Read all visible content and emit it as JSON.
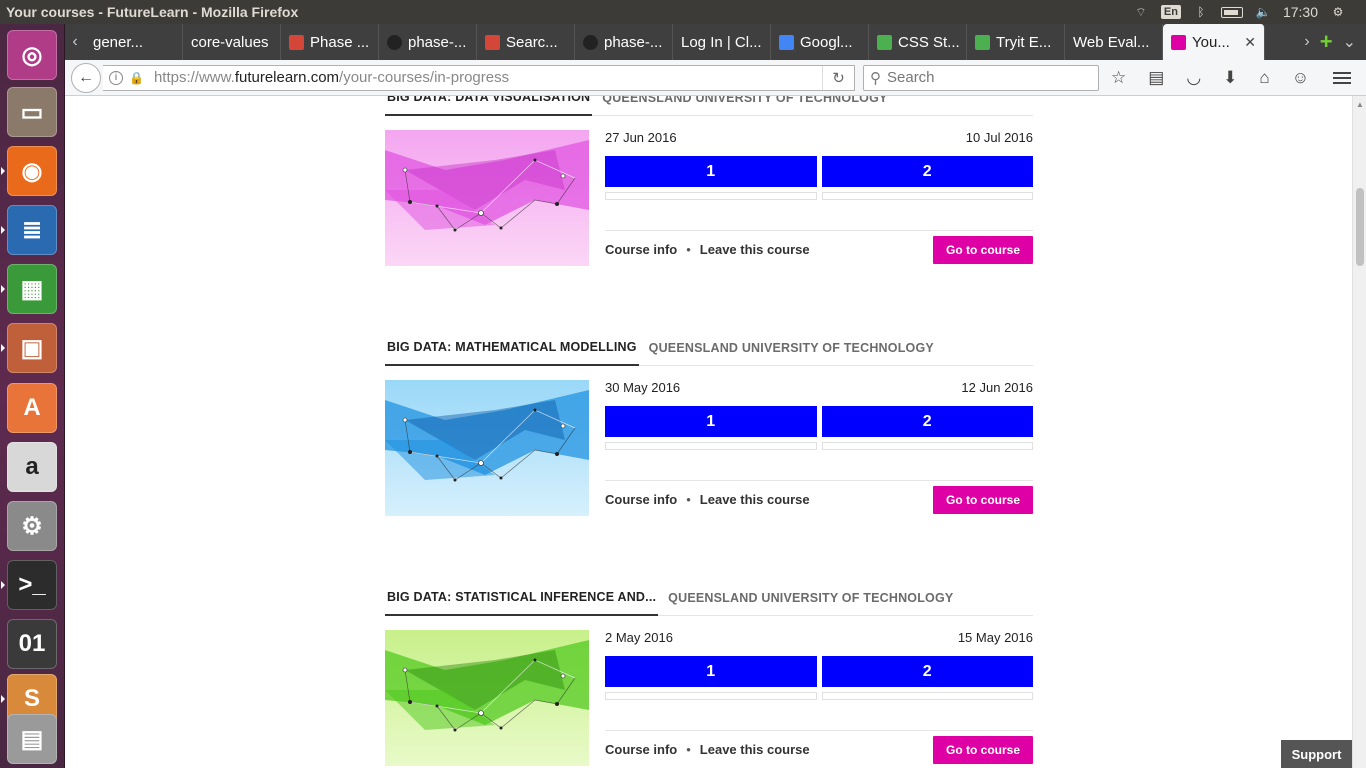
{
  "window": {
    "title": "Your courses - FutureLearn - Mozilla Firefox"
  },
  "tray": {
    "language": "En",
    "time": "17:30"
  },
  "launcher": {
    "items": [
      {
        "name": "ubuntu-dash",
        "glyph": "◎",
        "color": "#b03b87"
      },
      {
        "name": "files",
        "glyph": "▭",
        "color": "#8b7a6a"
      },
      {
        "name": "firefox",
        "glyph": "◉",
        "color": "#e86a1a"
      },
      {
        "name": "libreoffice-writer",
        "glyph": "≣",
        "color": "#2a6ab0"
      },
      {
        "name": "libreoffice-calc",
        "glyph": "▦",
        "color": "#3a9a3a"
      },
      {
        "name": "libreoffice-impress",
        "glyph": "▣",
        "color": "#c0603a"
      },
      {
        "name": "software-center",
        "glyph": "A",
        "color": "#e8743a"
      },
      {
        "name": "amazon",
        "glyph": "a",
        "color": "#d8d8d8"
      },
      {
        "name": "system-settings",
        "glyph": "⚙",
        "color": "#8a8a8a"
      },
      {
        "name": "terminal",
        "glyph": ">_",
        "color": "#2c2c2c"
      },
      {
        "name": "binary-editor",
        "glyph": "01",
        "color": "#3a3a3a"
      },
      {
        "name": "sublime-text",
        "glyph": "S",
        "color": "#d88a3a"
      },
      {
        "name": "workspaces",
        "glyph": "▤",
        "color": "#9a9a9a"
      }
    ]
  },
  "tabs": [
    {
      "label": "gener...",
      "fav": "none"
    },
    {
      "label": "core-values",
      "fav": "none"
    },
    {
      "label": "Phase ...",
      "fav": "gmail"
    },
    {
      "label": "phase-...",
      "fav": "github"
    },
    {
      "label": "Searc...",
      "fav": "gmail"
    },
    {
      "label": "phase-...",
      "fav": "github"
    },
    {
      "label": "Log In | Cl...",
      "fav": "none"
    },
    {
      "label": "Googl...",
      "fav": "google"
    },
    {
      "label": "CSS St...",
      "fav": "w3"
    },
    {
      "label": "Tryit E...",
      "fav": "w3"
    },
    {
      "label": "Web Eval...",
      "fav": "none"
    },
    {
      "label": "You...",
      "fav": "futurelearn",
      "active": true
    }
  ],
  "url": {
    "scheme": "https://www.",
    "host": "futurelearn.com",
    "path": "/your-courses/in-progress"
  },
  "search": {
    "placeholder": "Search"
  },
  "courses": [
    {
      "title": "BIG DATA: DATA VISUALISATION",
      "university": "QUEENSLAND UNIVERSITY OF TECHNOLOGY",
      "start_date": "27 Jun 2016",
      "end_date": "10 Jul 2016",
      "weeks": [
        "1",
        "2"
      ],
      "course_info": "Course info",
      "separator": "•",
      "leave": "Leave this course",
      "go": "Go to course",
      "image_theme": "pink"
    },
    {
      "title": "BIG DATA: MATHEMATICAL MODELLING",
      "university": "QUEENSLAND UNIVERSITY OF TECHNOLOGY",
      "start_date": "30 May 2016",
      "end_date": "12 Jun 2016",
      "weeks": [
        "1",
        "2"
      ],
      "course_info": "Course info",
      "separator": "•",
      "leave": "Leave this course",
      "go": "Go to course",
      "image_theme": "blue"
    },
    {
      "title": "BIG DATA: STATISTICAL INFERENCE AND...",
      "university": "QUEENSLAND UNIVERSITY OF TECHNOLOGY",
      "start_date": "2 May 2016",
      "end_date": "15 May 2016",
      "weeks": [
        "1",
        "2"
      ],
      "course_info": "Course info",
      "separator": "•",
      "leave": "Leave this course",
      "go": "Go to course",
      "image_theme": "green"
    }
  ],
  "support": {
    "label": "Support"
  },
  "colors": {
    "week_button": "#0000ff",
    "go_button": "#de00a5",
    "pink_theme": "#e86ae8",
    "blue_theme": "#2aa0e8",
    "green_theme": "#6ad82a"
  }
}
